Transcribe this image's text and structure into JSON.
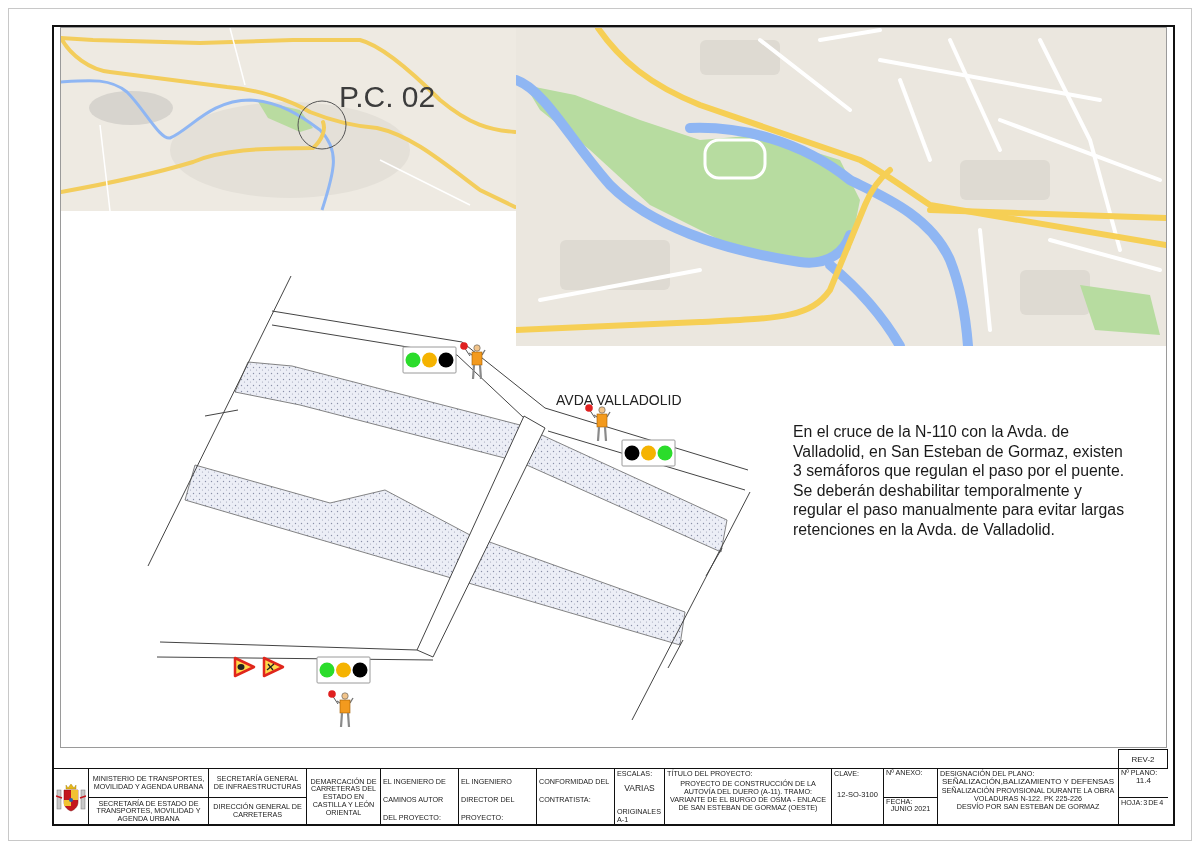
{
  "maps": {
    "callout": {
      "label": "P.C. 02"
    }
  },
  "plan": {
    "street_label": "AVDA VALLADOLID",
    "traffic_lights": [
      {
        "lamps": [
          {
            "color": "#2bdc2b"
          },
          {
            "color": "#f5b301"
          },
          {
            "color": "#000000"
          }
        ]
      },
      {
        "lamps": [
          {
            "color": "#000000"
          },
          {
            "color": "#f5b301"
          },
          {
            "color": "#2bdc2b"
          }
        ]
      },
      {
        "lamps": [
          {
            "color": "#2bdc2b"
          },
          {
            "color": "#f5b301"
          },
          {
            "color": "#000000"
          }
        ]
      }
    ],
    "note": "En el cruce de la N-110 con la Avda. de Valladolid, en San Esteban de Gormaz, existen 3 semáforos que regulan el paso por el puente. Se deberán deshabilitar temporalmente y regular el paso manualmente para evitar largas retenciones en la Avda. de Valladolid."
  },
  "title_block": {
    "rev": "REV-2",
    "ministry": "MINISTERIO DE TRANSPORTES, MOVILIDAD Y AGENDA URBANA",
    "secretary_of_state": "SECRETARÍA DE ESTADO DE TRANSPORTES, MOVILIDAD Y AGENDA URBANA",
    "general_secretariat": "SECRETARÍA GENERAL DE INFRAESTRUCTURAS",
    "directorate": "DIRECCIÓN GENERAL DE CARRETERAS",
    "demarcation": "DEMARCACIÓN DE CARRETERAS DEL ESTADO EN CASTILLA Y LEÓN ORIENTAL",
    "signatures": [
      "EL INGENIERO DE CAMINOS AUTOR DEL PROYECTO:",
      "EL INGENIERO DIRECTOR DEL PROYECTO:",
      "CONFORMIDAD DEL CONTRATISTA:"
    ],
    "scale": {
      "label": "ESCALAS:",
      "value": "VARIAS",
      "note": "ORIGINALES A-1"
    },
    "project": {
      "label": "TÍTULO DEL PROYECTO:",
      "value": "PROYECTO DE CONSTRUCCIÓN DE LA AUTOVÍA DEL DUERO (A-11). TRAMO: VARIANTE DE EL BURGO DE OSMA - ENLACE DE SAN ESTEBAN DE GORMAZ (OESTE)"
    },
    "key": {
      "label": "CLAVE:",
      "value": "12-SO-3100"
    },
    "annex": {
      "label": "Nº ANEXO:"
    },
    "date": {
      "label": "FECHA:",
      "value": "JUNIO 2021"
    },
    "designation": {
      "label": "DESIGNACIÓN DEL PLANO:",
      "title": "SEÑALIZACIÓN,BALIZAMIENTO Y DEFENSAS",
      "lines": [
        "SEÑALIZACIÓN PROVISIONAL DURANTE LA OBRA",
        "VOLADURAS N-122. PK 225-226",
        "DESVÍO POR SAN ESTEBAN DE GORMAZ"
      ]
    },
    "sheet_number": {
      "label": "Nº PLANO:",
      "value": "11.4"
    },
    "sheet": {
      "label": "HOJA:",
      "current": "3",
      "of": "DE",
      "total": "4"
    }
  }
}
